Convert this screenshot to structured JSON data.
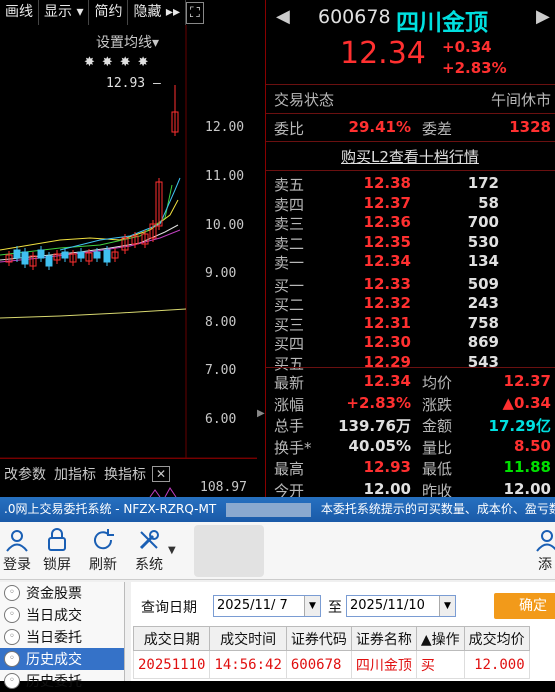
{
  "chart_toolbar": {
    "items": [
      "画线",
      "显示 ▾",
      "简约",
      "隐藏 ▸▸"
    ],
    "fullscreen_glyph": "⛶"
  },
  "chart_header": {
    "setting_label": "设置均线▾",
    "high_marker": "12.93 —"
  },
  "chart_data": {
    "type": "candlestick",
    "y_ticks": [
      "12.00",
      "11.00",
      "10.00",
      "9.00",
      "8.00",
      "7.00",
      "6.00"
    ],
    "bottom_value": "108.97"
  },
  "chart_bottom": {
    "items": [
      "改参数",
      "加指标",
      "换指标"
    ],
    "close_glyph": "✕"
  },
  "quote": {
    "code": "600678",
    "name": "四川金顶",
    "price": "12.34",
    "change": "+0.34",
    "change_pct": "+2.83%",
    "status_label": "交易状态",
    "status_value": "午间休市",
    "weibi_label": "委比",
    "weibi_value": "29.41%",
    "weicha_label": "委差",
    "weicha_value": "1328",
    "l2_link": "购买L2查看十档行情",
    "asks": [
      {
        "label": "卖五",
        "price": "12.38",
        "vol": "172"
      },
      {
        "label": "卖四",
        "price": "12.37",
        "vol": "58"
      },
      {
        "label": "卖三",
        "price": "12.36",
        "vol": "700"
      },
      {
        "label": "卖二",
        "price": "12.35",
        "vol": "530"
      },
      {
        "label": "卖一",
        "price": "12.34",
        "vol": "134"
      }
    ],
    "bids": [
      {
        "label": "买一",
        "price": "12.33",
        "vol": "509"
      },
      {
        "label": "买二",
        "price": "12.32",
        "vol": "243"
      },
      {
        "label": "买三",
        "price": "12.31",
        "vol": "758"
      },
      {
        "label": "买四",
        "price": "12.30",
        "vol": "869"
      },
      {
        "label": "买五",
        "price": "12.29",
        "vol": "543"
      }
    ],
    "stats": [
      {
        "l1": "最新",
        "v1": "12.34",
        "c1": "red",
        "l2": "均价",
        "v2": "12.37",
        "c2": "red"
      },
      {
        "l1": "涨幅",
        "v1": "+2.83%",
        "c1": "red",
        "l2": "涨跌",
        "v2": "▲0.34",
        "c2": "red"
      },
      {
        "l1": "总手",
        "v1": "139.76万",
        "c1": "wht",
        "l2": "金额",
        "v2": "17.29亿",
        "c2": "cyan"
      },
      {
        "l1": "换手*",
        "v1": "40.05%",
        "c1": "wht",
        "l2": "量比",
        "v2": "8.50",
        "c2": "red"
      },
      {
        "l1": "最高",
        "v1": "12.93",
        "c1": "red",
        "l2": "最低",
        "v2": "11.88",
        "c2": "green"
      },
      {
        "l1": "今开",
        "v1": "12.00",
        "c1": "wht",
        "l2": "昨收",
        "v2": "12.00",
        "c2": "wht"
      }
    ]
  },
  "window": {
    "title_left": ".0网上交易委托系统 - NFZX-RZRQ-MT",
    "title_right": "本委托系统提示的可买数量、成本价、盈亏数据仅",
    "toolbar": [
      "登录",
      "锁屏",
      "刷新",
      "系统"
    ],
    "toolbar_right": "添",
    "sidebar": [
      "资金股票",
      "当日成交",
      "当日委托",
      "历史成交",
      "历史委托"
    ],
    "query_label": "查询日期",
    "date_from": "2025/11/ 7",
    "to_label": "至",
    "date_to": "2025/11/10",
    "confirm": "确定",
    "columns": [
      "成交日期",
      "成交时间",
      "证券代码",
      "证券名称",
      "▲操作",
      "成交均价"
    ],
    "rows": [
      [
        "20251110",
        "14:56:42",
        "600678",
        "四川金顶",
        "买",
        "12.000"
      ]
    ]
  }
}
